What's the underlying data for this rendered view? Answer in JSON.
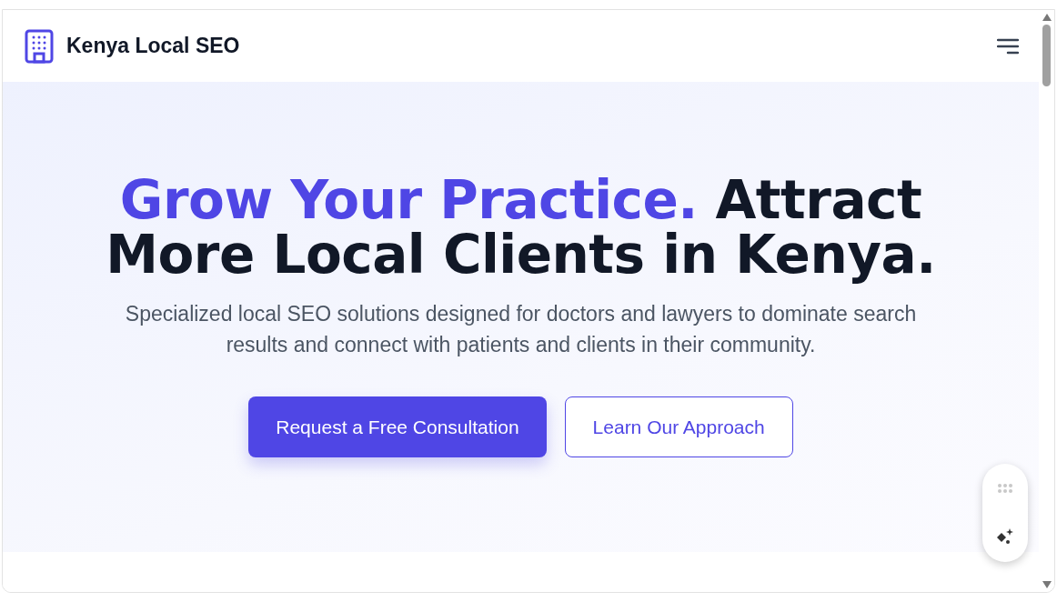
{
  "header": {
    "brand": "Kenya Local SEO"
  },
  "hero": {
    "title_highlight": "Grow Your Practice.",
    "title_rest": "Attract More Local Clients in Kenya.",
    "subtitle": "Specialized local SEO solutions designed for doctors and lawyers to dominate search results and connect with patients and clients in their community.",
    "buttons": [
      {
        "label": "Request a Free Consultation",
        "kind": "primary"
      },
      {
        "label": "Learn Our Approach",
        "kind": "outline"
      }
    ]
  }
}
